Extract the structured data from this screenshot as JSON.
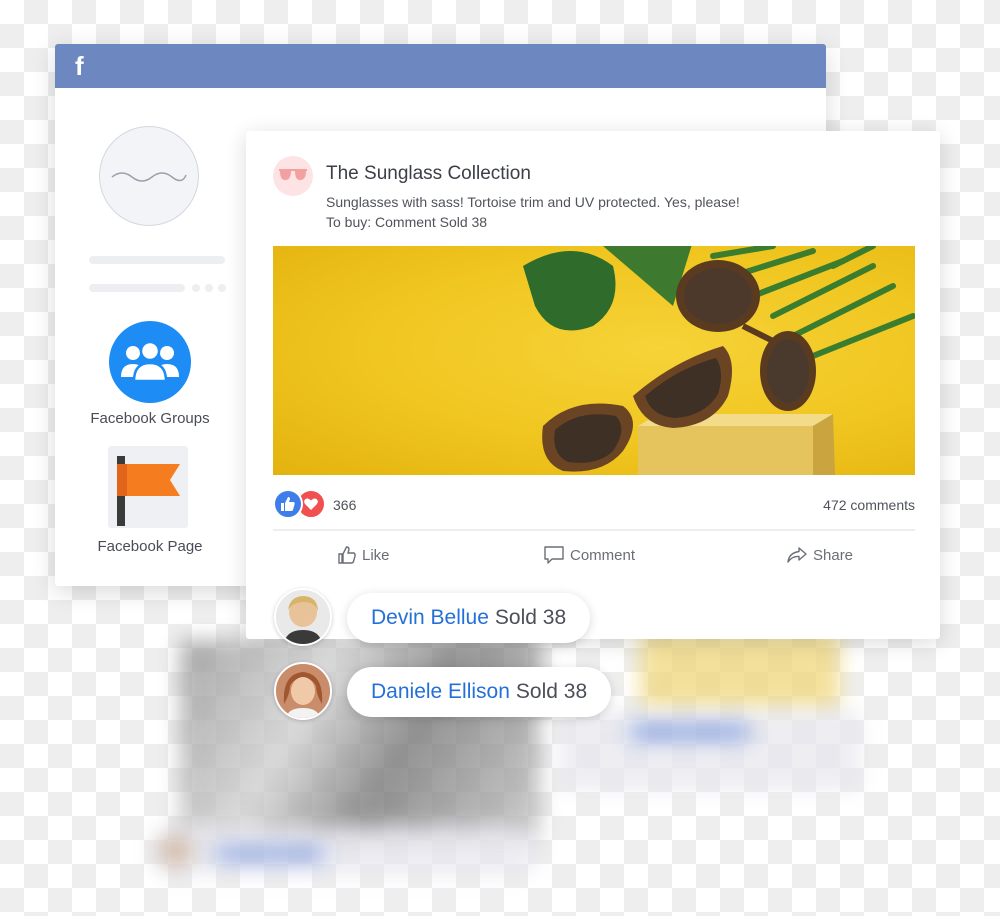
{
  "facebook_window": {
    "logo": "f",
    "sidebar": {
      "groups_label": "Facebook Groups",
      "page_label": "Facebook Page"
    }
  },
  "post": {
    "page_name": "The Sunglass Collection",
    "text_line1": "Sunglasses with sass! Tortoise trim and UV protected. Yes, please!",
    "text_line2": "To buy: Comment Sold 38",
    "reaction_count": "366",
    "comments_count": "472 comments",
    "actions": {
      "like": "Like",
      "comment": "Comment",
      "share": "Share"
    }
  },
  "comments": [
    {
      "name": "Devin Bellue",
      "text": "Sold 38"
    },
    {
      "name": "Daniele Ellison",
      "text": "Sold 38"
    }
  ],
  "colors": {
    "facebook_blue": "#6d87c1",
    "groups_blue": "#1d8cf5",
    "flag_orange": "#f57c1f",
    "link_blue": "#2470d8",
    "image_yellow": "#f0c51f"
  },
  "icons": [
    "facebook-logo-icon",
    "groups-icon",
    "flag-icon",
    "sunglasses-icon",
    "like-reaction-icon",
    "love-reaction-icon",
    "thumbs-up-icon",
    "comment-icon",
    "share-icon"
  ]
}
